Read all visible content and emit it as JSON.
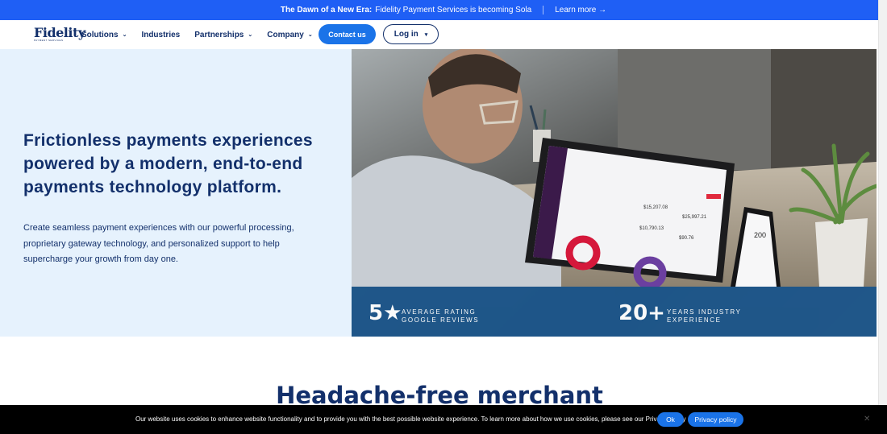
{
  "announcement": {
    "bold": "The Dawn of a New Era:",
    "text": "Fidelity Payment Services is becoming Sola",
    "link": "Learn more →"
  },
  "nav": {
    "logo_text": "Fidelity",
    "logo_sub": "PAYMENT SERVICES",
    "items": [
      {
        "label": "Solutions",
        "dropdown": true
      },
      {
        "label": "Industries",
        "dropdown": false
      },
      {
        "label": "Partnerships",
        "dropdown": true
      },
      {
        "label": "Company",
        "dropdown": true
      }
    ],
    "contact_label": "Contact us",
    "login_label": "Log in",
    "login_caret": "▾"
  },
  "hero": {
    "title_line1": "Frictionless payments experiences",
    "title_line2": "powered by a modern,",
    "title_bold_1": "end-to-end",
    "title_bold_2": "payments technology platform.",
    "description": "Create seamless payment experiences with our powerful processing, proprietary gateway technology, and personalized support to help supercharge your growth from day one."
  },
  "stats": [
    {
      "value": "5★",
      "label_1": "AVERAGE RATING",
      "label_2": "GOOGLE REVIEWS"
    },
    {
      "value": "20+",
      "label_1": "YEARS INDUSTRY",
      "label_2": "EXPERIENCE"
    }
  ],
  "photo": {
    "screen_values": [
      "$15,207.08",
      "$25,997.21",
      "$10,790.13",
      "$90.76"
    ],
    "phone_value": "200"
  },
  "section_title": "Headache-free merchant",
  "cookie": {
    "text": "Our website uses cookies to enhance website functionality and to provide you with the best possible website experience. To learn more about how we use cookies, please see our Privacy Policy",
    "ok_label": "Ok",
    "privacy_label": "Privacy policy",
    "close_glyph": "✕"
  },
  "colors": {
    "brand_navy": "#13306b",
    "announce_blue": "#1f5ff5",
    "button_blue": "#1a73e8",
    "hero_bg": "#e6f2fd",
    "stats_bg": "#1d568a"
  }
}
